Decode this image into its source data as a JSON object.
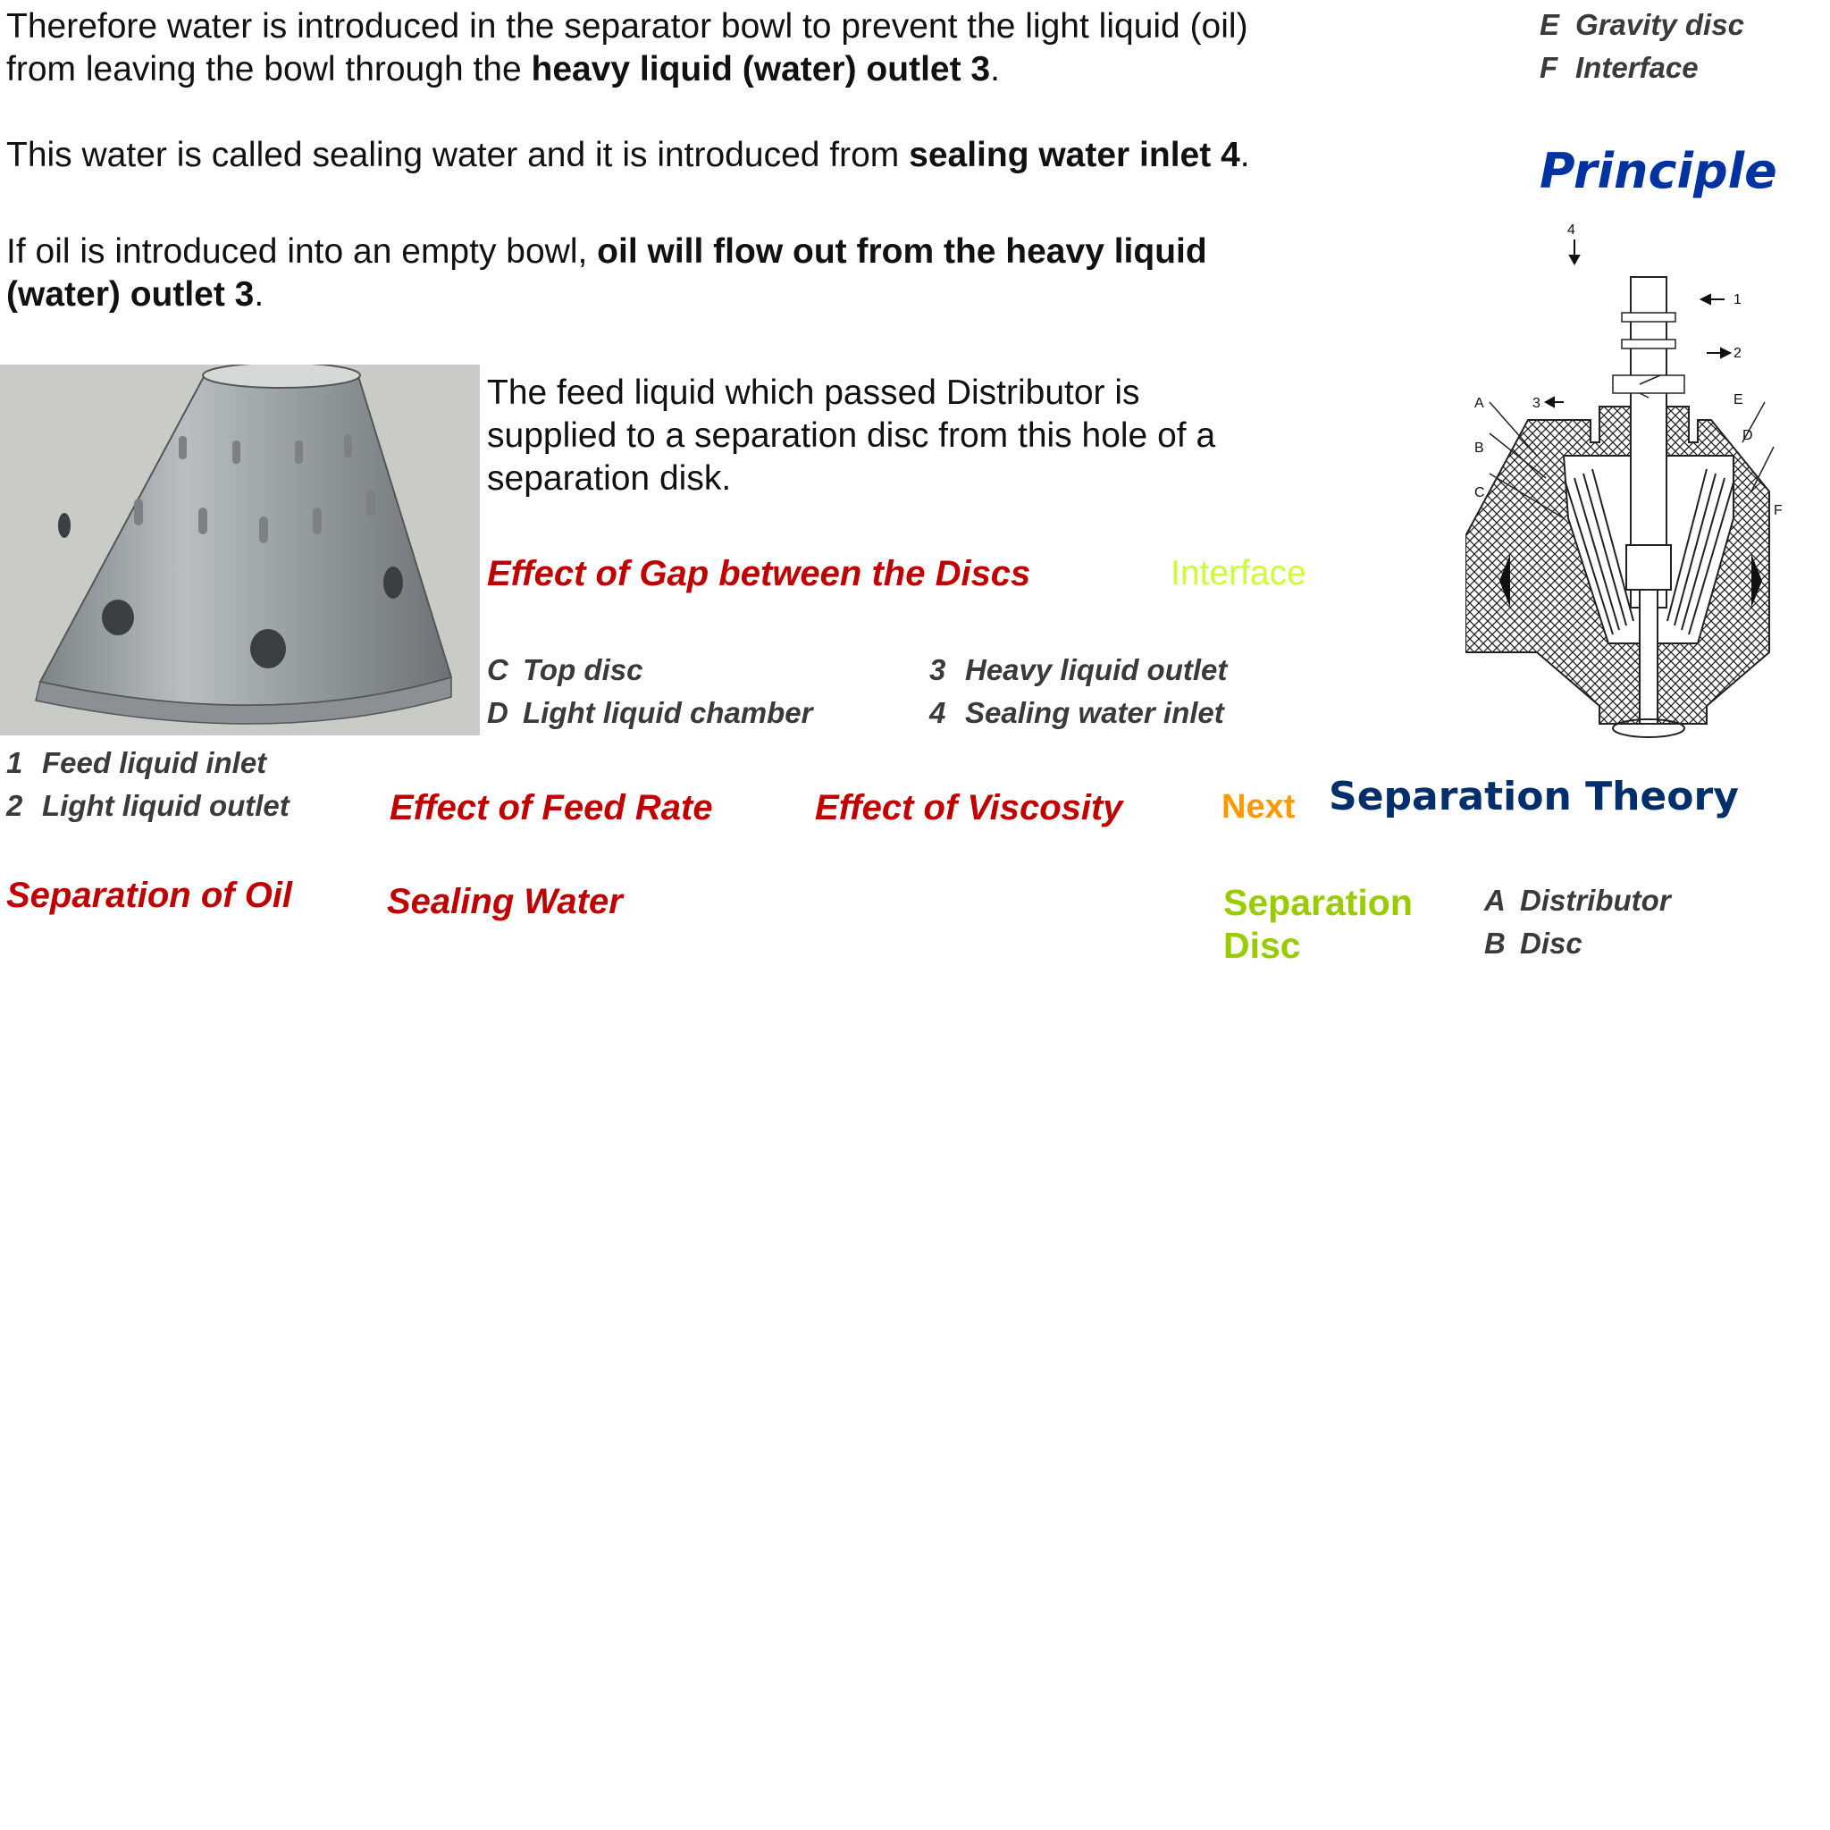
{
  "paragraphs": {
    "p1": {
      "line1": "Therefore water is introduced in the separator bowl to prevent the light liquid (oil)",
      "line2_pre": "from leaving the bowl through the ",
      "line2_bold": "heavy liquid (water) outlet 3",
      "line2_post": "."
    },
    "p2": {
      "pre": "This water is called sealing water and it is introduced from ",
      "bold": "sealing water inlet 4",
      "post": "."
    },
    "p3": {
      "line1_pre": "If oil is introduced into an empty bowl, ",
      "line1_bold": "oil will flow out from the heavy liquid",
      "line2_bold": "(water) outlet 3",
      "line2_post": "."
    },
    "p4": {
      "line1": "The feed liquid which passed Distributor is",
      "line2": "supplied to a separation disc from this hole of a",
      "line3": "separation disk."
    }
  },
  "legend": {
    "E": {
      "code": "E",
      "label": "Gravity disc"
    },
    "F": {
      "code": "F",
      "label": "Interface"
    },
    "C": {
      "code": "C",
      "label": "Top disc"
    },
    "D": {
      "code": "D",
      "label": "Light liquid chamber"
    },
    "n3": {
      "code": "3",
      "label": "Heavy liquid outlet"
    },
    "n4": {
      "code": "4",
      "label": "Sealing water inlet"
    },
    "n1": {
      "code": "1",
      "label": "Feed liquid inlet"
    },
    "n2": {
      "code": "2",
      "label": "Light liquid outlet"
    },
    "A": {
      "code": "A",
      "label": "Distributor"
    },
    "B": {
      "code": "B",
      "label": "Disc"
    }
  },
  "headings": {
    "principle": "Principle",
    "separation_theory": "Separation Theory"
  },
  "links": {
    "gap_between_discs": "Effect of Gap between the Discs",
    "interface": "Interface",
    "feed_rate": "Effect of Feed Rate",
    "viscosity": "Effect of Viscosity",
    "next": "Next",
    "separation_of_oil": "Separation of Oil",
    "sealing_water": "Sealing Water",
    "separation_disc_line1": "Separation",
    "separation_disc_line2": "Disc"
  },
  "diagram_labels": {
    "n4": "4",
    "n1": "1",
    "n2": "2",
    "n3": "3",
    "A": "A",
    "B": "B",
    "C": "C",
    "D": "D",
    "E": "E",
    "F": "F"
  },
  "colors": {
    "link_red": "#c00000",
    "link_green": "#99cc00",
    "link_orange": "#ff9900",
    "principle_blue": "#0033a0",
    "theory_navy": "#002f6c",
    "interface_yellow_green": "#ccff33",
    "legend_gray": "#3a3a3a"
  }
}
